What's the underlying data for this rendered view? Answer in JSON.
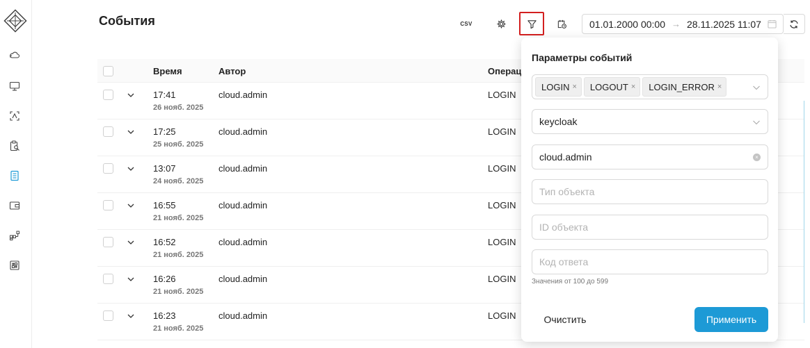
{
  "header": {
    "title": "События",
    "csv_label": "CSV",
    "date_from": "01.01.2000 00:00",
    "date_to": "28.11.2025 11:07",
    "date_arrow": "→"
  },
  "table": {
    "columns": [
      "Время",
      "Автор",
      "Операц"
    ],
    "rows": [
      {
        "time": "17:41",
        "date": "26 нояб. 2025",
        "author": "cloud.admin",
        "operation": "LOGIN"
      },
      {
        "time": "17:25",
        "date": "25 нояб. 2025",
        "author": "cloud.admin",
        "operation": "LOGIN"
      },
      {
        "time": "13:07",
        "date": "24 нояб. 2025",
        "author": "cloud.admin",
        "operation": "LOGIN"
      },
      {
        "time": "16:55",
        "date": "21 нояб. 2025",
        "author": "cloud.admin",
        "operation": "LOGIN"
      },
      {
        "time": "16:52",
        "date": "21 нояб. 2025",
        "author": "cloud.admin",
        "operation": "LOGIN"
      },
      {
        "time": "16:26",
        "date": "21 нояб. 2025",
        "author": "cloud.admin",
        "operation": "LOGIN"
      },
      {
        "time": "16:23",
        "date": "21 нояб. 2025",
        "author": "cloud.admin",
        "operation": "LOGIN"
      }
    ]
  },
  "filter_panel": {
    "title": "Параметры событий",
    "operation_tags": [
      "LOGIN",
      "LOGOUT",
      "LOGIN_ERROR"
    ],
    "tag_remove": "×",
    "source_value": "keycloak",
    "author_value": "cloud.admin",
    "author_clear": "×",
    "object_type_placeholder": "Тип объекта",
    "object_id_placeholder": "ID объекта",
    "response_code_placeholder": "Код ответа",
    "response_code_hint": "Значения от 100 до 599",
    "clear_label": "Очистить",
    "apply_label": "Применить"
  },
  "colors": {
    "accent": "#1d9ad6",
    "highlight_border": "#d31f1f",
    "active_nav": "#1d9ad6"
  },
  "icons": {
    "sidebar": [
      "cloud-icon",
      "monitor-icon",
      "scan-icon",
      "clipboard-search-icon",
      "journal-icon",
      "wallet-icon",
      "hierarchy-icon",
      "dashboard-icon"
    ]
  }
}
